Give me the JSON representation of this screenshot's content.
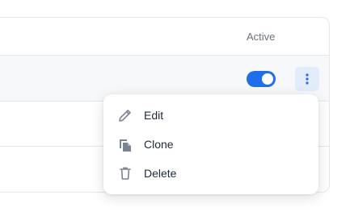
{
  "table": {
    "header": {
      "active_label": "Active"
    },
    "rows": [
      {
        "active": true
      }
    ]
  },
  "menu": {
    "items": [
      {
        "label": "Edit",
        "icon": "pencil-icon"
      },
      {
        "label": "Clone",
        "icon": "copy-icon"
      },
      {
        "label": "Delete",
        "icon": "trash-icon"
      }
    ]
  },
  "colors": {
    "accent": "#1f6feb",
    "icon_gray": "#7b8290",
    "kebab_bg": "#e3ecfb"
  }
}
